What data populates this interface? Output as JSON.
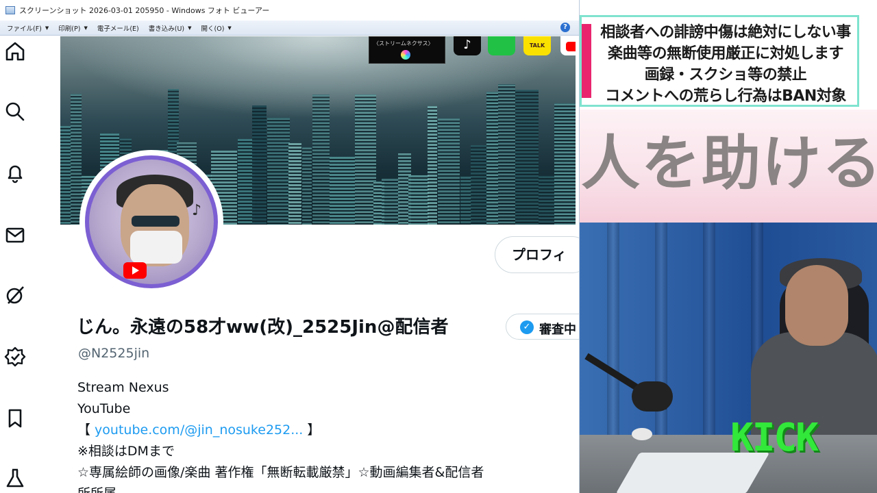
{
  "viewer": {
    "title": "スクリーンショット 2026-03-01 205950 - Windows フォト ビューアー",
    "menu": [
      {
        "label": "ファイル(F)"
      },
      {
        "label": "印刷(P)"
      },
      {
        "label": "電子メール(E)"
      },
      {
        "label": "書き込み(U)"
      },
      {
        "label": "開く(O)"
      }
    ],
    "help_icon": "help-icon"
  },
  "profile": {
    "banner_logo_text": "〈ストリームネクサス〉",
    "talk_logo_text": "TALK",
    "edit_profile_label": "プロフィ",
    "display_name": "じん。永遠の58才ww(改)_2525Jin@配信者",
    "verify_label": "審査中",
    "handle": "@N2525jin",
    "bio": {
      "line1": "Stream Nexus",
      "line2": "YouTube",
      "line3_prefix": "【 ",
      "line3_link": "youtube.com/@jin_nosuke252...",
      "line3_suffix": " 】",
      "line4": "※相談はDMまで",
      "line5": "☆専属絵師の画像/楽曲 著作権「無断転載厳禁」☆動画編集者&配信者",
      "line6": "所所属"
    },
    "rail_icons": [
      "home-icon",
      "search-icon",
      "notifications-icon",
      "messages-icon",
      "grok-icon",
      "verified-icon",
      "bookmarks-icon",
      "labs-icon"
    ]
  },
  "overlay": {
    "notice": [
      "相談者への誹謗中傷は絶対にしない事",
      "楽曲等の無断使用厳正に対処します",
      "画録・スクショ等の禁止",
      "コメントへの荒らし行為はBAN対象"
    ],
    "big_text": "人を助ける",
    "kick_label": "KICK",
    "colors": {
      "notice_border": "#7fe3cf",
      "notice_tab": "#e8256d",
      "kick_green": "#32e83a"
    }
  }
}
